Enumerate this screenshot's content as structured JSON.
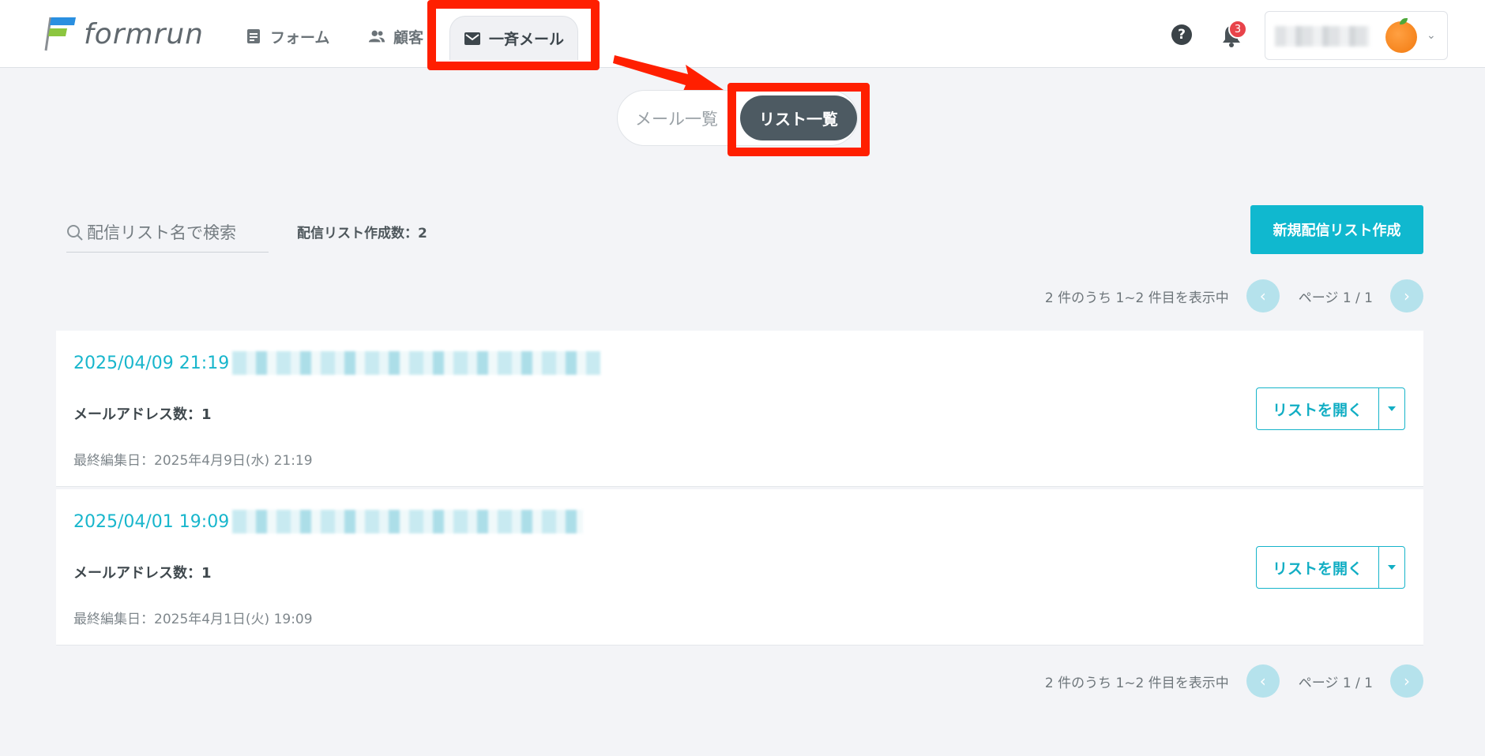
{
  "header": {
    "logo_text": "formrun",
    "nav": {
      "forms": "フォーム",
      "customers": "顧客",
      "mail": "一斉メール"
    },
    "help_glyph": "?",
    "notification_count": "3"
  },
  "segment": {
    "mail_list": "メール一覧",
    "list_list": "リスト一覧"
  },
  "toolbar": {
    "search_placeholder": "配信リスト名で検索",
    "count_label": "配信リスト作成数：2",
    "new_button": "新規配信リスト作成"
  },
  "pagination": {
    "info": "2 件のうち 1~2 件目を表示中",
    "page": "ページ 1 / 1"
  },
  "lists": [
    {
      "title": "2025/04/09 21:19",
      "count_label": "メールアドレス数：1",
      "updated": "最終編集日：2025年4月9日(水) 21:19",
      "open_label": "リストを開く"
    },
    {
      "title": "2025/04/01 19:09",
      "count_label": "メールアドレス数：1",
      "updated": "最終編集日：2025年4月1日(火) 19:09",
      "open_label": "リストを開く"
    }
  ],
  "colors": {
    "accent": "#10b8cf",
    "highlight": "#ff1f00",
    "dark_pill": "#4d5a62"
  }
}
